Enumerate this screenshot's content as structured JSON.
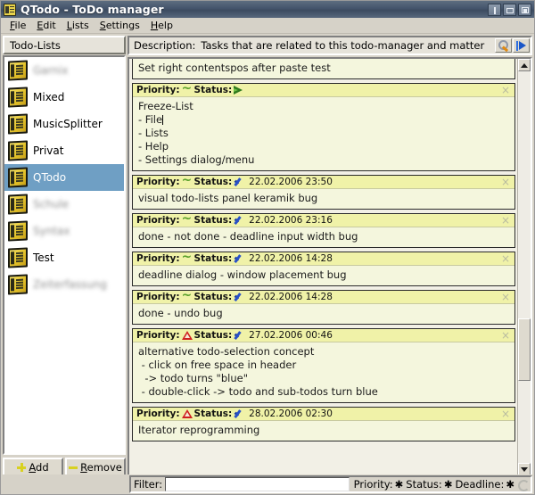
{
  "window": {
    "title": "QTodo - ToDo manager",
    "icon": "app-icon",
    "controls": {
      "shade": "shade",
      "maximize": "maximize",
      "close": "close"
    }
  },
  "menubar": {
    "items": [
      {
        "label": "File",
        "accel": "F"
      },
      {
        "label": "Edit",
        "accel": "E"
      },
      {
        "label": "Lists",
        "accel": "L"
      },
      {
        "label": "Settings",
        "accel": "S"
      },
      {
        "label": "Help",
        "accel": "H"
      }
    ]
  },
  "sidebar": {
    "header": "Todo-Lists",
    "items": [
      {
        "label": "Garnix",
        "selected": false,
        "blurred": true
      },
      {
        "label": "Mixed",
        "selected": false,
        "blurred": false
      },
      {
        "label": "MusicSplitter",
        "selected": false,
        "blurred": false
      },
      {
        "label": "Privat",
        "selected": false,
        "blurred": false
      },
      {
        "label": "QTodo",
        "selected": true,
        "blurred": false
      },
      {
        "label": "Schule",
        "selected": false,
        "blurred": true
      },
      {
        "label": "Syntax",
        "selected": false,
        "blurred": true
      },
      {
        "label": "Test",
        "selected": false,
        "blurred": false
      },
      {
        "label": "Zeiterfassung",
        "selected": false,
        "blurred": true
      }
    ],
    "add_button": {
      "label": "Add",
      "accel": "A"
    },
    "remove_button": {
      "label": "Remove",
      "accel": "R"
    }
  },
  "description": {
    "label": "Description:",
    "value": "Tasks that are related to this todo-manager and matter",
    "tool_button": "wrench-icon",
    "go_button": "play-icon"
  },
  "todos": {
    "partial_top": {
      "body": "Set right contentspos after paste test"
    },
    "items": [
      {
        "priority_label": "Priority:",
        "priority_icon": "wave",
        "status_label": "Status:",
        "status_icon": "arrow",
        "date": "",
        "body": "Freeze-List\n- File\n- Lists\n- Help\n- Settings dialog/menu",
        "has_caret": true,
        "caret_line": 1,
        "close": "×"
      },
      {
        "priority_label": "Priority:",
        "priority_icon": "wave",
        "status_label": "Status:",
        "status_icon": "check",
        "date": "22.02.2006 23:50",
        "body": "visual todo-lists panel keramik bug",
        "has_caret": false,
        "close": "×"
      },
      {
        "priority_label": "Priority:",
        "priority_icon": "wave",
        "status_label": "Status:",
        "status_icon": "check",
        "date": "22.02.2006 23:16",
        "body": "done - not done - deadline input width bug",
        "has_caret": false,
        "close": "×"
      },
      {
        "priority_label": "Priority:",
        "priority_icon": "wave",
        "status_label": "Status:",
        "status_icon": "check",
        "date": "22.02.2006 14:28",
        "body": "deadline dialog - window placement bug",
        "has_caret": false,
        "close": "×"
      },
      {
        "priority_label": "Priority:",
        "priority_icon": "wave",
        "status_label": "Status:",
        "status_icon": "check",
        "date": "22.02.2006 14:28",
        "body": "done - undo bug",
        "has_caret": false,
        "close": "×"
      },
      {
        "priority_label": "Priority:",
        "priority_icon": "warn",
        "status_label": "Status:",
        "status_icon": "check",
        "date": "27.02.2006 00:46",
        "body": "alternative todo-selection concept\n - click on free space in header\n  -> todo turns \"blue\"\n - double-click -> todo and sub-todos turn blue",
        "has_caret": false,
        "close": "×"
      },
      {
        "priority_label": "Priority:",
        "priority_icon": "warn",
        "status_label": "Status:",
        "status_icon": "check",
        "date": "28.02.2006 02:30",
        "body": "Iterator reprogramming",
        "has_caret": false,
        "close": "×"
      }
    ]
  },
  "statusbar": {
    "filter_label": "Filter:",
    "filter_value": "",
    "filter_placeholder": "",
    "priority_label": "Priority:",
    "priority_value": "✱",
    "status_label": "Status:",
    "status_value": "✱",
    "deadline_label": "Deadline:",
    "deadline_value": "✱",
    "refresh_icon": "refresh-icon"
  },
  "colors": {
    "titlebar": "#44546b",
    "selection": "#6f9fc4",
    "card_bg": "#f4f6dd",
    "card_header": "#f0f2a8",
    "accent_yellow": "#d8d120",
    "priority_warn": "#cf2020",
    "status_check": "#2850c8",
    "status_arrow": "#2f7a1d"
  }
}
